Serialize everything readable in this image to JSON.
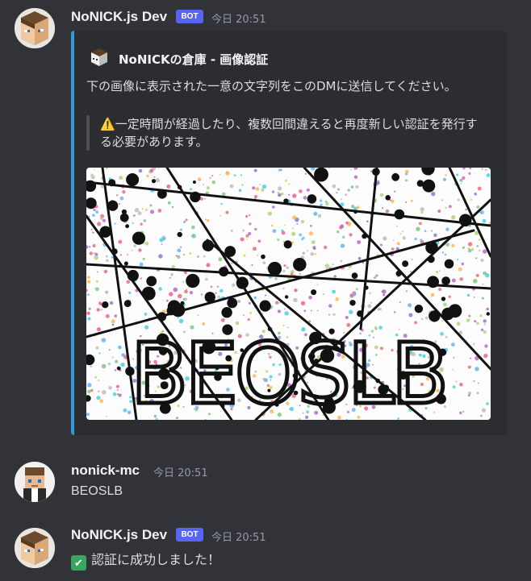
{
  "messages": [
    {
      "username": "NoNICK.js Dev",
      "badge": "BOT",
      "timestamp": "今日 20:51",
      "embed": {
        "author_icon": "cube-bot-icon",
        "title": "NoNICKの倉庫 - 画像認証",
        "description": "下の画像に表示された一意の文字列をこのDMに送信してください。",
        "quote_emoji": "⚠️",
        "quote": "一定時間が経過したり、複数回間違えると再度新しい認証を発行する必要があります。",
        "captcha_text": "BEOSLB"
      }
    },
    {
      "username": "nonick-mc",
      "timestamp": "今日 20:51",
      "content": "BEOSLB"
    },
    {
      "username": "NoNICK.js Dev",
      "badge": "BOT",
      "timestamp": "今日 20:51",
      "emoji": "✅",
      "content": "認証に成功しました！"
    }
  ],
  "colors": {
    "background": "#313338",
    "embed_background": "#2b2d31",
    "embed_accent": "#3498db",
    "bot_badge": "#5865f2",
    "success": "#3ba55d"
  }
}
